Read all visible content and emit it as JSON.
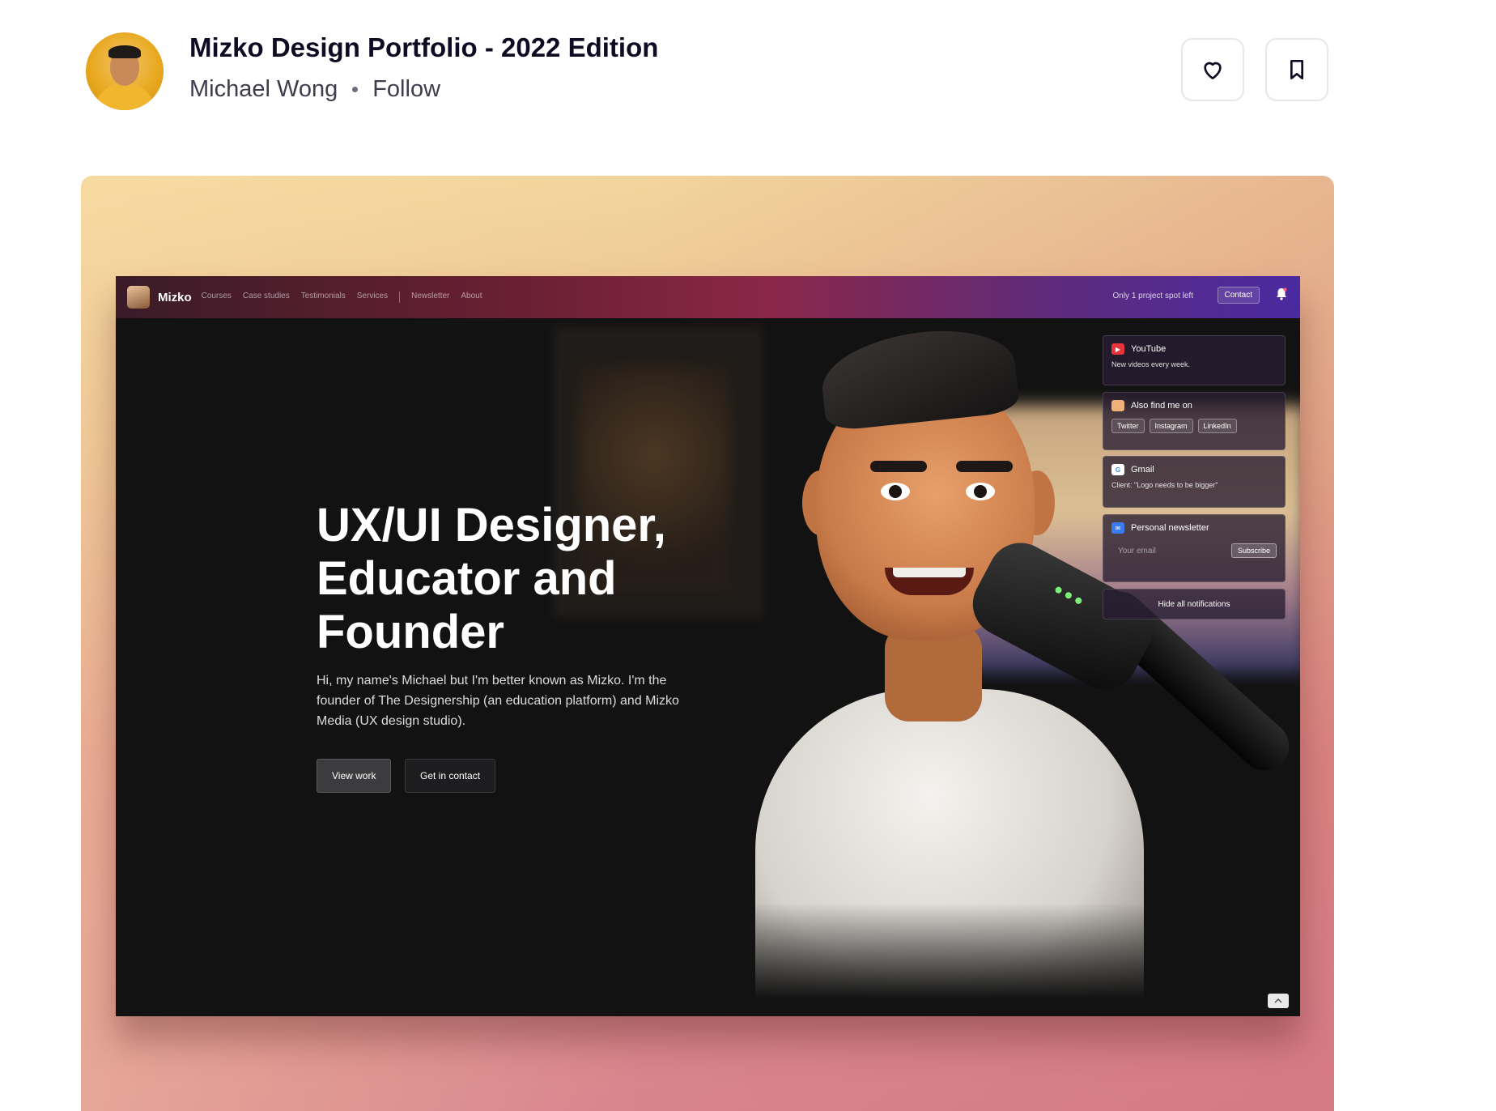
{
  "shot": {
    "title": "Mizko Design Portfolio - 2022 Edition",
    "author": "Michael Wong",
    "follow_label": "Follow"
  },
  "actions": {
    "like_icon": "heart-icon",
    "save_icon": "bookmark-icon"
  },
  "preview": {
    "brand": "Mizko",
    "nav_links": [
      "Courses",
      "Case studies",
      "Testimonials",
      "Services",
      "Newsletter",
      "About"
    ],
    "spot_text": "Only 1 project spot left",
    "contact_label": "Contact",
    "hero_title": "UX/UI Designer, Educator and Founder",
    "hero_desc": "Hi, my name's Michael but I'm better known as Mizko. I'm the founder of The Designership (an education platform) and Mizko Media (UX design studio).",
    "view_work_label": "View work",
    "get_in_contact_label": "Get in contact",
    "notifications": {
      "youtube_title": "YouTube",
      "youtube_sub": "New videos every week.",
      "find_title": "Also find me on",
      "find_links": [
        "Twitter",
        "Instagram",
        "LinkedIn"
      ],
      "gmail_title": "Gmail",
      "gmail_sub": "Client: \"Logo needs to be bigger\"",
      "newsletter_title": "Personal newsletter",
      "email_placeholder": "Your email",
      "subscribe_label": "Subscribe",
      "hide_label": "Hide all notifications"
    }
  },
  "colors": {
    "title": "#0d0c22",
    "byline": "#3d3d4e",
    "card_top": "#f2d59c",
    "card_bottom": "#d8848e"
  }
}
